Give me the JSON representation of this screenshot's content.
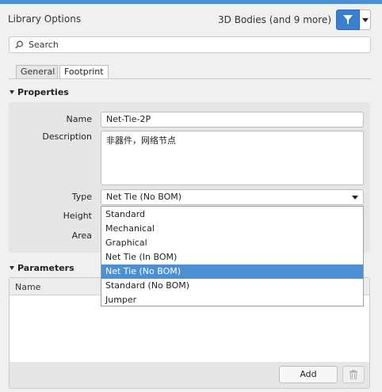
{
  "header": {
    "title": "Library Options",
    "filter_label": "3D Bodies (and 9 more)"
  },
  "search": {
    "placeholder": "Search"
  },
  "tabs": [
    {
      "label": "General",
      "active": false
    },
    {
      "label": "Footprint",
      "active": true
    }
  ],
  "properties": {
    "section_label": "Properties",
    "name_label": "Name",
    "name_value": "Net-Tie-2P",
    "description_label": "Description",
    "description_value": "非器件，网络节点",
    "type_label": "Type",
    "type_value": "Net Tie (No BOM)",
    "height_label": "Height",
    "area_label": "Area"
  },
  "type_options": [
    {
      "label": "Standard",
      "selected": false
    },
    {
      "label": "Mechanical",
      "selected": false
    },
    {
      "label": "Graphical",
      "selected": false
    },
    {
      "label": "Net Tie (In BOM)",
      "selected": false
    },
    {
      "label": "Net Tie (No BOM)",
      "selected": true
    },
    {
      "label": "Standard (No BOM)",
      "selected": false
    },
    {
      "label": "Jumper",
      "selected": false
    }
  ],
  "parameters": {
    "section_label": "Parameters",
    "column_name": "Name",
    "add_label": "Add"
  },
  "colors": {
    "accent": "#4a90d2",
    "filter_button": "#3a7fd0"
  },
  "icons": {
    "filter": "filter-funnel-icon",
    "search": "search-magnifier-icon",
    "delete": "trash-icon",
    "collapse": "collapse-triangle-icon",
    "dropdown": "chevron-down-icon"
  }
}
